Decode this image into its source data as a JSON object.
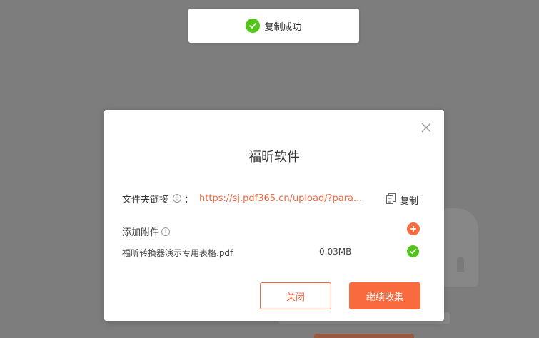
{
  "toast": {
    "message": "复制成功",
    "icon": "check-circle-icon",
    "color": "#52c41a"
  },
  "dialog": {
    "title": "福昕软件",
    "close_icon": "close-icon",
    "link": {
      "label": "文件夹链接",
      "info_icon": "info-icon",
      "colon": "：",
      "url": "https://sj.pdf365.cn/upload/?para..."
    },
    "copy": {
      "label": "复制",
      "icon": "copy-icon"
    },
    "attachments": {
      "label": "添加附件",
      "info_icon": "info-icon",
      "add_icon": "plus-icon",
      "files": [
        {
          "name": "福昕转换器演示专用表格.pdf",
          "size": "0.03MB",
          "status_icon": "check-circle-icon"
        }
      ]
    },
    "buttons": {
      "close_label": "关闭",
      "continue_label": "继续收集"
    }
  },
  "colors": {
    "accent": "#f96b3f",
    "link": "#f1663f",
    "success": "#52c41a",
    "overlay": "#7d7d7d"
  }
}
